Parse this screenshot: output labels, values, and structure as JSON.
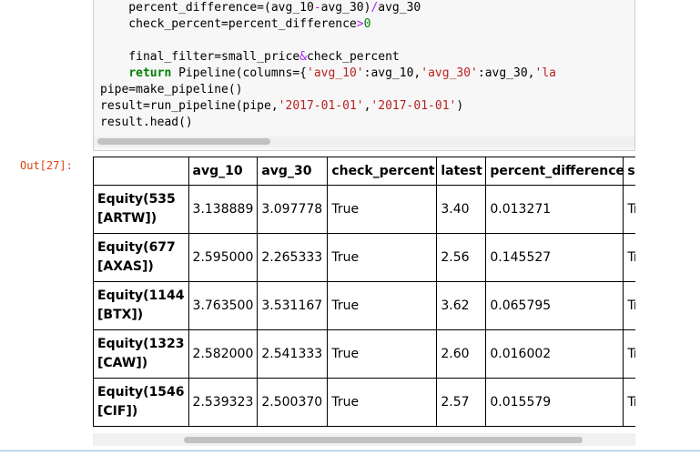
{
  "code_lines": [
    [
      {
        "t": "    percent_difference=(avg_10"
      },
      {
        "t": "-",
        "c": "op"
      },
      {
        "t": "avg_30)"
      },
      {
        "t": "/",
        "c": "op"
      },
      {
        "t": "avg_30"
      }
    ],
    [
      {
        "t": "    check_percent=percent_difference"
      },
      {
        "t": ">",
        "c": "op"
      },
      {
        "t": "0",
        "c": "num"
      }
    ],
    [
      {
        "t": ""
      }
    ],
    [
      {
        "t": "    final_filter=small_price"
      },
      {
        "t": "&",
        "c": "op"
      },
      {
        "t": "check_percent"
      }
    ],
    [
      {
        "t": "    "
      },
      {
        "t": "return",
        "c": "kw"
      },
      {
        "t": " Pipeline(columns={"
      },
      {
        "t": "'avg_10'",
        "c": "str"
      },
      {
        "t": ":avg_10,"
      },
      {
        "t": "'avg_30'",
        "c": "str"
      },
      {
        "t": ":avg_30,"
      },
      {
        "t": "'la",
        "c": "str"
      }
    ],
    [
      {
        "t": "pipe=make_pipeline()"
      }
    ],
    [
      {
        "t": "result=run_pipeline(pipe,"
      },
      {
        "t": "'2017-01-01'",
        "c": "str"
      },
      {
        "t": ","
      },
      {
        "t": "'2017-01-01'",
        "c": "str"
      },
      {
        "t": ")"
      }
    ],
    [
      {
        "t": "result.head()"
      }
    ]
  ],
  "output_prompt": "Out[27]:",
  "table": {
    "columns": [
      "",
      "avg_10",
      "avg_30",
      "check_percent",
      "latest",
      "percent_difference",
      "sm"
    ],
    "rows": [
      {
        "index": "Equity(535 [ARTW])",
        "cells": [
          "3.138889",
          "3.097778",
          "True",
          "3.40",
          "0.013271",
          "Tru"
        ]
      },
      {
        "index": "Equity(677 [AXAS])",
        "cells": [
          "2.595000",
          "2.265333",
          "True",
          "2.56",
          "0.145527",
          "Tru"
        ]
      },
      {
        "index": "Equity(1144 [BTX])",
        "cells": [
          "3.763500",
          "3.531167",
          "True",
          "3.62",
          "0.065795",
          "Tru"
        ]
      },
      {
        "index": "Equity(1323 [CAW])",
        "cells": [
          "2.582000",
          "2.541333",
          "True",
          "2.60",
          "0.016002",
          "Tru"
        ]
      },
      {
        "index": "Equity(1546 [CIF])",
        "cells": [
          "2.539323",
          "2.500370",
          "True",
          "2.57",
          "0.015579",
          "Tru"
        ]
      }
    ]
  }
}
